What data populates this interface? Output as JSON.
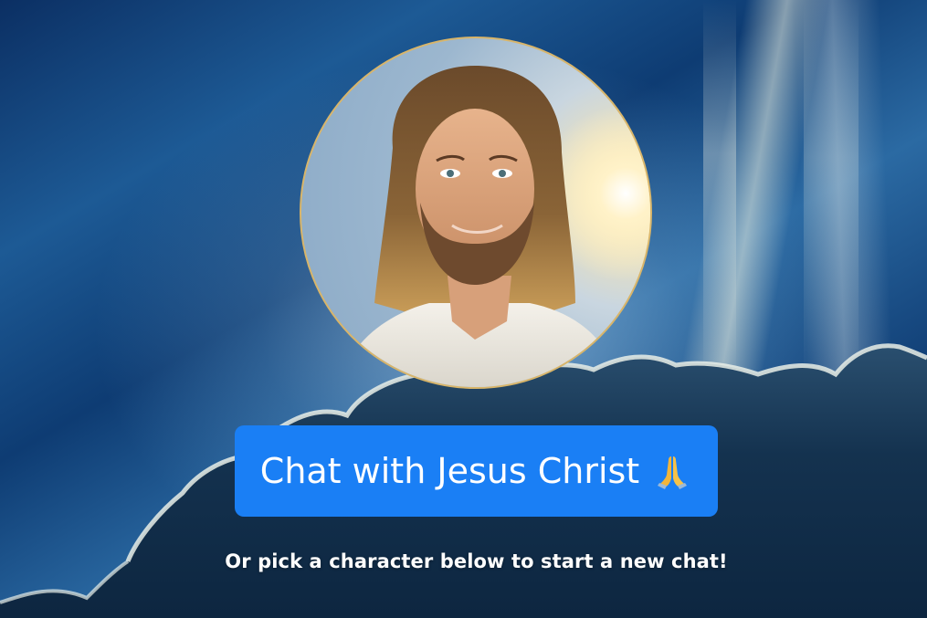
{
  "hero": {
    "avatar_icon": "jesus-portrait",
    "chat_button_label": "Chat with Jesus Christ",
    "chat_button_icon": "praying-hands-icon",
    "subtitle": "Or pick a character below to start a new chat!"
  },
  "colors": {
    "button": "#1a7ff5",
    "avatar_border": "#d8b56a",
    "sky_dark": "#0b2f63",
    "cloud": "#13324f"
  }
}
